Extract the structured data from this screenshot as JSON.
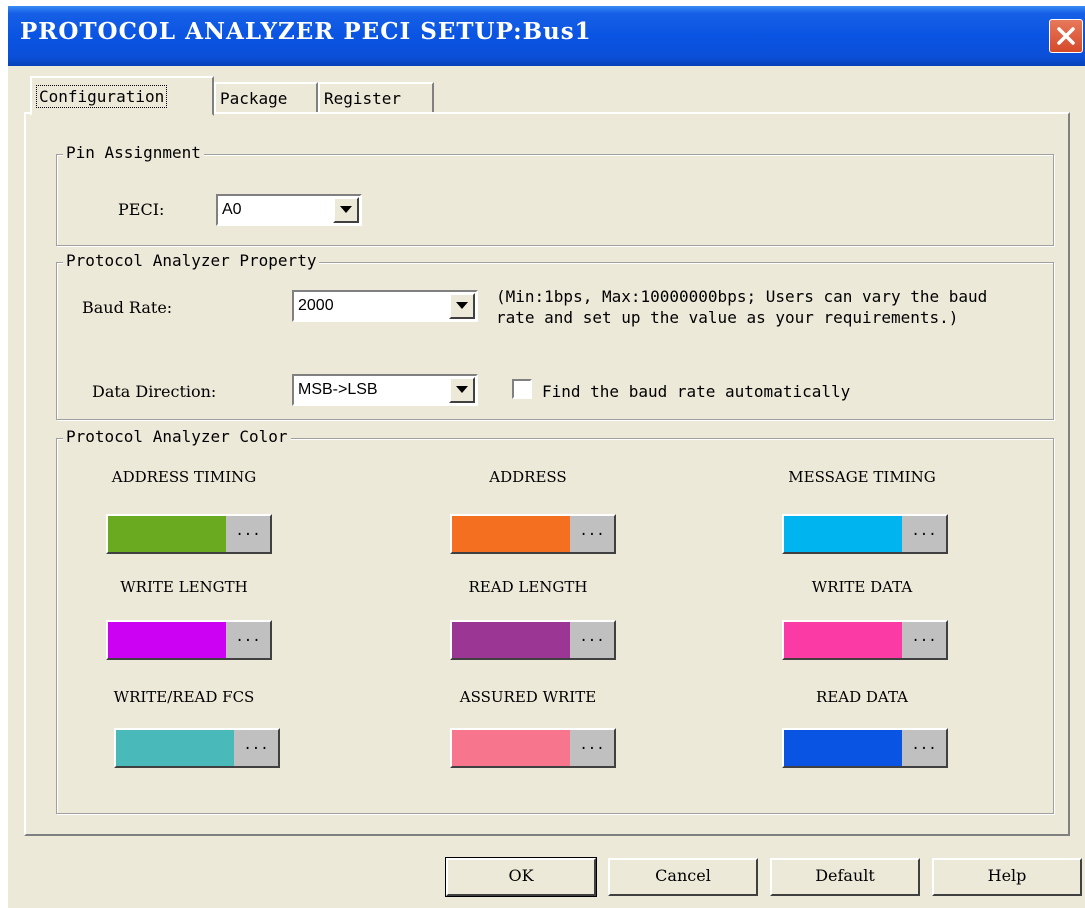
{
  "window": {
    "title": "PROTOCOL ANALYZER PECI SETUP:Bus1"
  },
  "tabs": [
    {
      "label": "Configuration",
      "active": true
    },
    {
      "label": "Package",
      "active": false
    },
    {
      "label": "Register",
      "active": false
    }
  ],
  "pin_assignment": {
    "group_label": "Pin Assignment",
    "peci_label": "PECI:",
    "peci_value": "A0"
  },
  "property": {
    "group_label": "Protocol Analyzer Property",
    "baud_label": "Baud Rate:",
    "baud_value": "2000",
    "note": "(Min:1bps, Max:10000000bps; Users can vary the baud rate and set up the value as your requirements.)",
    "direction_label": "Data Direction:",
    "direction_value": "MSB->LSB",
    "auto_baud_label": "Find the baud rate automatically",
    "auto_baud_checked": false
  },
  "colors": {
    "group_label": "Protocol Analyzer Color",
    "items": [
      {
        "label": "ADDRESS TIMING",
        "color": "#6aaa21",
        "dots": "..."
      },
      {
        "label": "ADDRESS",
        "color": "#f47020",
        "dots": "..."
      },
      {
        "label": "MESSAGE TIMING",
        "color": "#00b4f0",
        "dots": "..."
      },
      {
        "label": "WRITE LENGTH",
        "color": "#cc00f2",
        "dots": "..."
      },
      {
        "label": "READ LENGTH",
        "color": "#9b3694",
        "dots": "..."
      },
      {
        "label": "WRITE DATA",
        "color": "#fb3aa6",
        "dots": "..."
      },
      {
        "label": "WRITE/READ FCS",
        "color": "#4ab9b9",
        "dots": "..."
      },
      {
        "label": "ASSURED WRITE",
        "color": "#f7758d",
        "dots": "..."
      },
      {
        "label": "READ DATA",
        "color": "#0a54e3",
        "dots": "..."
      }
    ]
  },
  "buttons": {
    "ok": "OK",
    "cancel": "Cancel",
    "default": "Default",
    "help": "Help"
  }
}
